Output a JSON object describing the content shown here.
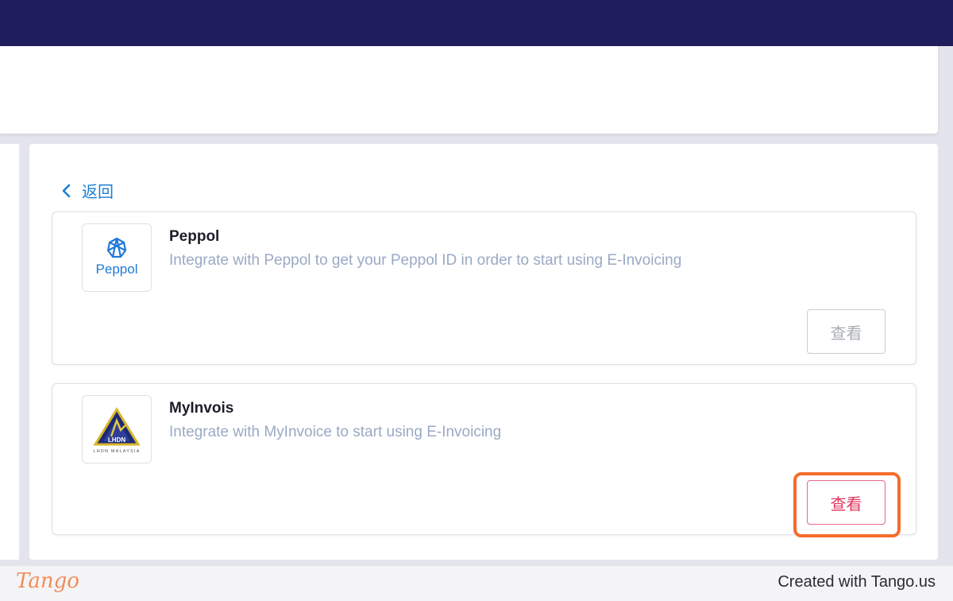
{
  "page": {
    "back_label": "返回"
  },
  "integrations": [
    {
      "logo_text": "Peppol",
      "title": "Peppol",
      "description": "Integrate with Peppol to get your Peppol ID in order to start using E-Invoicing",
      "button_label": "查看",
      "button_state": "disabled"
    },
    {
      "logo_text": "LHDN MALAYSIA",
      "title": "MyInvois",
      "description": "Integrate with MyInvoice to start using E-Invoicing",
      "button_label": "查看",
      "button_state": "active"
    }
  ],
  "footer": {
    "brand": "Tango",
    "credit": "Created with Tango.us"
  },
  "colors": {
    "topbar": "#1f1d5c",
    "link": "#1a7fd6",
    "active_button_text": "#e0365c",
    "highlight": "#f46d2b"
  }
}
